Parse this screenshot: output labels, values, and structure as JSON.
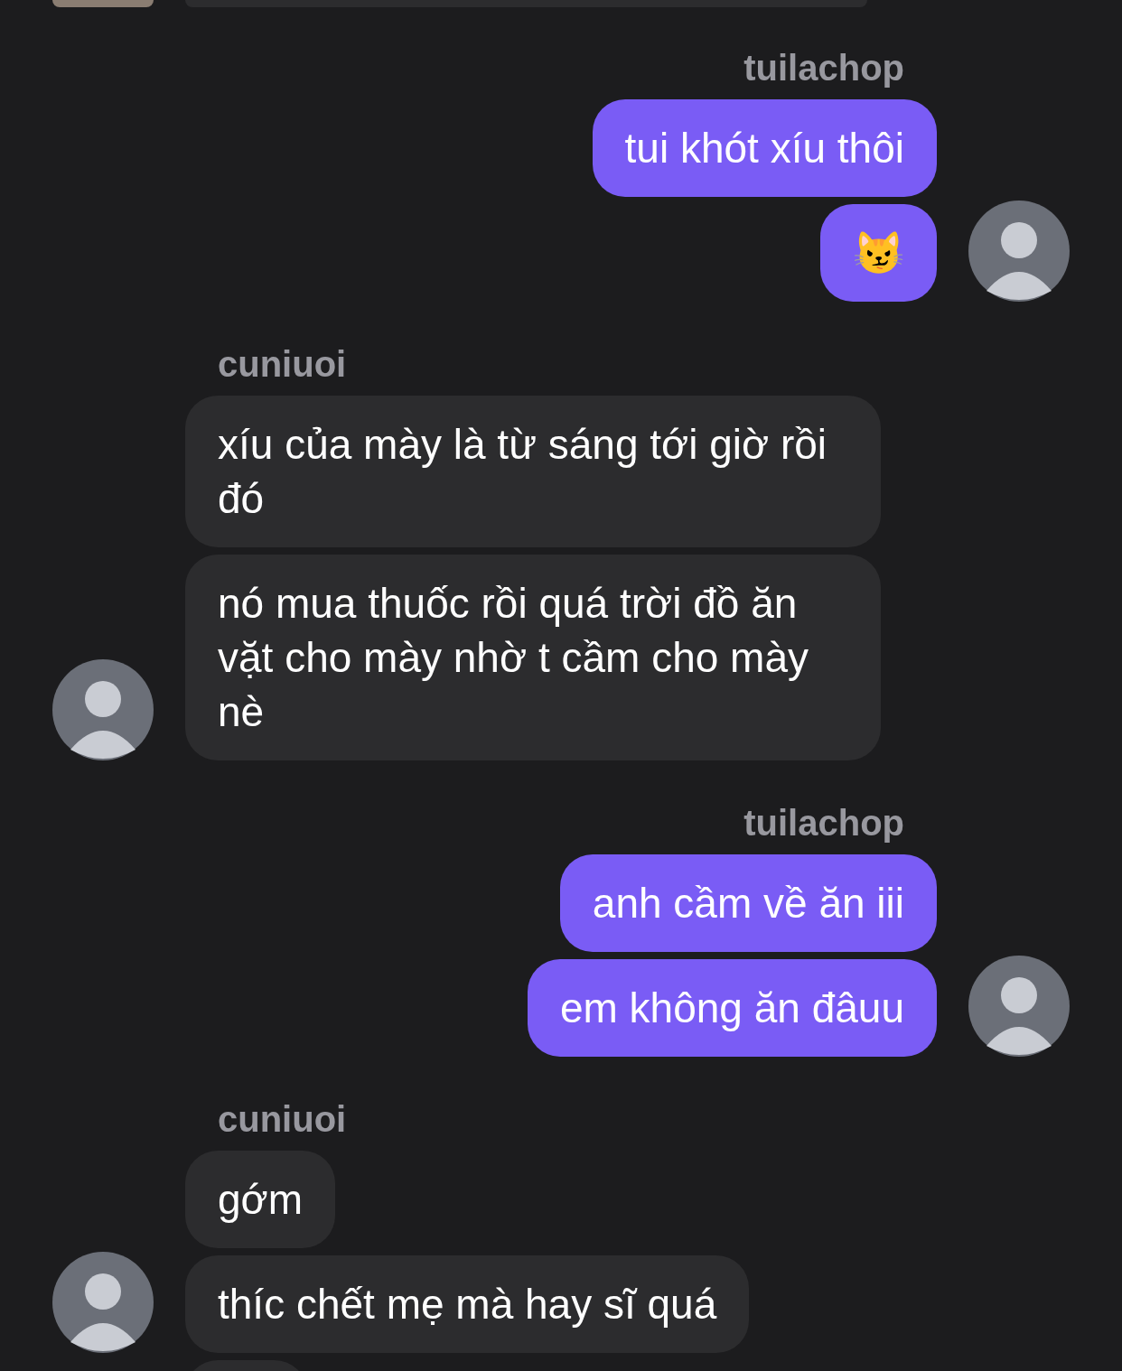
{
  "groups": [
    {
      "sender": "tuilachop",
      "kind": "outgoing",
      "messages": [
        {
          "text": "tui khót xíu thôi"
        },
        {
          "text": "😼"
        }
      ]
    },
    {
      "sender": "cuniuoi",
      "kind": "incoming",
      "messages": [
        {
          "text": "xíu của mày là từ sáng tới giờ rồi đó"
        },
        {
          "text": "nó mua thuốc rồi quá trời đồ ăn vặt cho mày nhờ t cầm cho mày nè"
        }
      ]
    },
    {
      "sender": "tuilachop",
      "kind": "outgoing",
      "messages": [
        {
          "text": "anh cầm về ăn iii"
        },
        {
          "text": "em không ăn đâuu"
        }
      ]
    },
    {
      "sender": "cuniuoi",
      "kind": "incoming",
      "messages": [
        {
          "text": "gớm"
        },
        {
          "text": "thíc chết mẹ mà hay sĩ quá"
        }
      ]
    }
  ]
}
